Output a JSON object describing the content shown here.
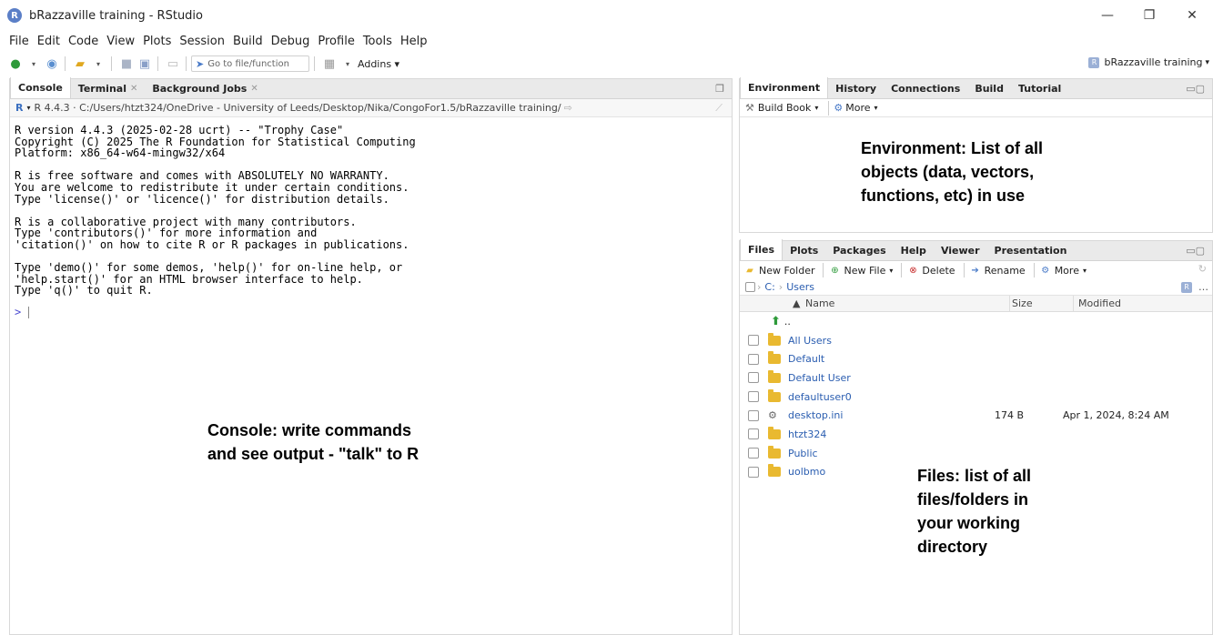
{
  "window": {
    "title": "bRazzaville training - RStudio",
    "logo_letter": "R",
    "minimize": "—",
    "maximize": "❐",
    "close": "✕"
  },
  "menu": [
    "File",
    "Edit",
    "Code",
    "View",
    "Plots",
    "Session",
    "Build",
    "Debug",
    "Profile",
    "Tools",
    "Help"
  ],
  "toolbar": {
    "goto_placeholder": "Go to file/function",
    "addins_label": "Addins",
    "project_label": "bRazzaville training"
  },
  "console_pane": {
    "tabs": [
      {
        "label": "Console",
        "active": true,
        "closable": false
      },
      {
        "label": "Terminal",
        "active": false,
        "closable": true
      },
      {
        "label": "Background Jobs",
        "active": false,
        "closable": true
      }
    ],
    "version_path": "R 4.4.3 · C:/Users/htzt324/OneDrive - University of Leeds/Desktop/Nika/CongoFor1.5/bRazzaville training/",
    "output": "R version 4.4.3 (2025-02-28 ucrt) -- \"Trophy Case\"\nCopyright (C) 2025 The R Foundation for Statistical Computing\nPlatform: x86_64-w64-mingw32/x64\n\nR is free software and comes with ABSOLUTELY NO WARRANTY.\nYou are welcome to redistribute it under certain conditions.\nType 'license()' or 'licence()' for distribution details.\n\nR is a collaborative project with many contributors.\nType 'contributors()' for more information and\n'citation()' on how to cite R or R packages in publications.\n\nType 'demo()' for some demos, 'help()' for on-line help, or\n'help.start()' for an HTML browser interface to help.\nType 'q()' to quit R.",
    "prompt": ">"
  },
  "env_pane": {
    "tabs": [
      {
        "label": "Environment",
        "active": true
      },
      {
        "label": "History",
        "active": false
      },
      {
        "label": "Connections",
        "active": false
      },
      {
        "label": "Build",
        "active": false
      },
      {
        "label": "Tutorial",
        "active": false
      }
    ],
    "build_book": "Build Book",
    "more": "More"
  },
  "files_pane": {
    "tabs": [
      {
        "label": "Files",
        "active": true
      },
      {
        "label": "Plots",
        "active": false
      },
      {
        "label": "Packages",
        "active": false
      },
      {
        "label": "Help",
        "active": false
      },
      {
        "label": "Viewer",
        "active": false
      },
      {
        "label": "Presentation",
        "active": false
      }
    ],
    "actions": {
      "new_folder": "New Folder",
      "new_file": "New File",
      "delete": "Delete",
      "rename": "Rename",
      "more": "More"
    },
    "breadcrumb": {
      "drive": "C:",
      "folder": "Users"
    },
    "columns": {
      "name": "Name",
      "size": "Size",
      "modified": "Modified"
    },
    "up_label": "..",
    "rows": [
      {
        "name": "All Users",
        "size": "",
        "modified": "",
        "kind": "folder"
      },
      {
        "name": "Default",
        "size": "",
        "modified": "",
        "kind": "folder"
      },
      {
        "name": "Default User",
        "size": "",
        "modified": "",
        "kind": "folder"
      },
      {
        "name": "defaultuser0",
        "size": "",
        "modified": "",
        "kind": "folder"
      },
      {
        "name": "desktop.ini",
        "size": "174 B",
        "modified": "Apr 1, 2024, 8:24 AM",
        "kind": "file"
      },
      {
        "name": "htzt324",
        "size": "",
        "modified": "",
        "kind": "folder"
      },
      {
        "name": "Public",
        "size": "",
        "modified": "",
        "kind": "folder"
      },
      {
        "name": "uolbmo",
        "size": "",
        "modified": "",
        "kind": "folder"
      }
    ]
  },
  "annotations": {
    "environment": [
      "Environment: List of all",
      "objects (data, vectors,",
      "functions, etc) in use"
    ],
    "console": [
      "Console: write commands",
      "and see output - \"talk\" to R"
    ],
    "files": [
      "Files: list of all",
      "files/folders in",
      "your working",
      "directory"
    ]
  },
  "colors": {
    "accent": "#2a5db0",
    "folder": "#e9b930",
    "tab_bar": "#eaeaea"
  }
}
